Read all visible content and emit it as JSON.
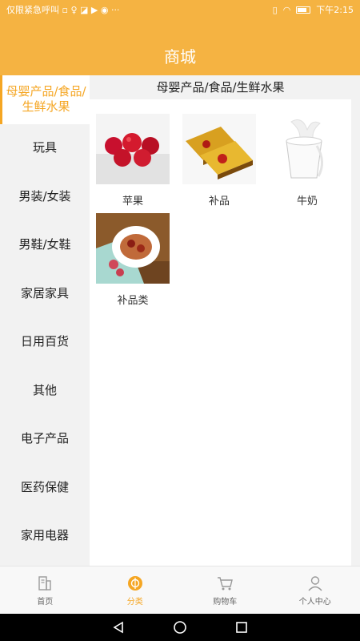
{
  "status_bar": {
    "left_text": "仅限紧急呼叫 ▫ ♀ ◪ ▶ ◉ ···",
    "time": "下午2:15"
  },
  "header": {
    "title": "商城"
  },
  "sidebar": {
    "items": [
      {
        "label": "母婴产品/食品/生鲜水果"
      },
      {
        "label": "玩具"
      },
      {
        "label": "男装/女装"
      },
      {
        "label": "男鞋/女鞋"
      },
      {
        "label": "家居家具"
      },
      {
        "label": "日用百货"
      },
      {
        "label": "其他"
      },
      {
        "label": "电子产品"
      },
      {
        "label": "医药保健"
      },
      {
        "label": "家用电器"
      }
    ]
  },
  "main": {
    "category_title": "母婴产品/食品/生鲜水果",
    "products": [
      {
        "name": "苹果"
      },
      {
        "name": "补品"
      },
      {
        "name": "牛奶"
      },
      {
        "name": "补品类"
      }
    ]
  },
  "tabbar": {
    "tabs": [
      {
        "label": "首页"
      },
      {
        "label": "分类"
      },
      {
        "label": "购物车"
      },
      {
        "label": "个人中心"
      }
    ]
  },
  "colors": {
    "accent": "#f5a623",
    "header": "#f5b342"
  }
}
